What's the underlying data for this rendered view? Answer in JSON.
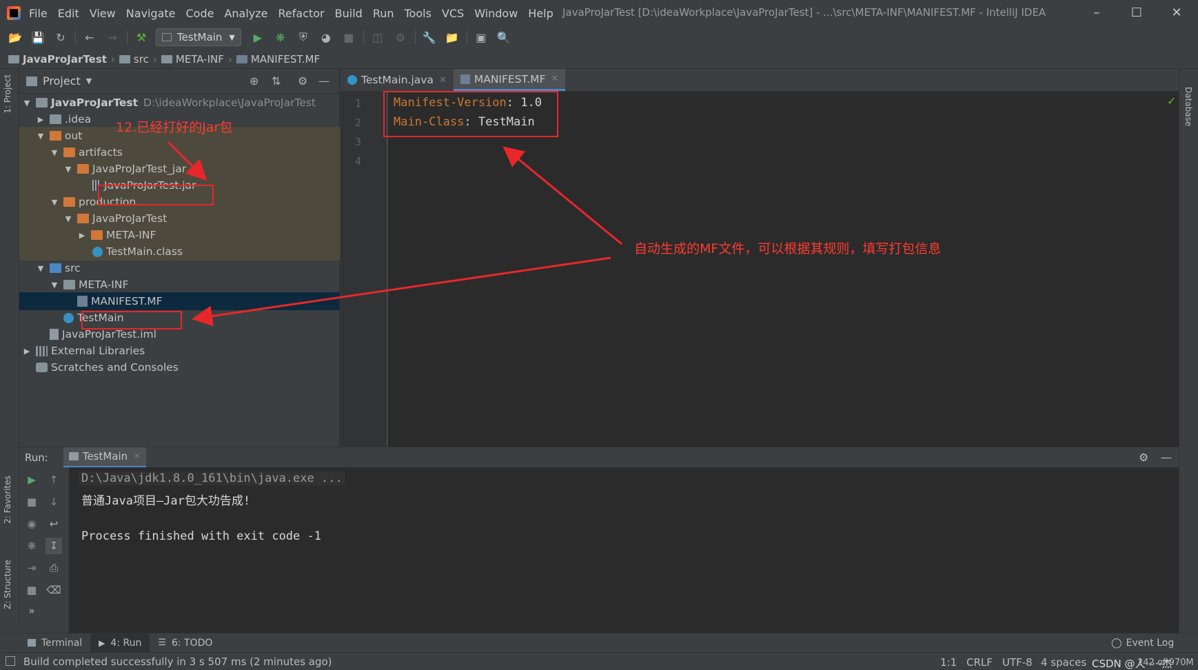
{
  "window": {
    "title": "JavaProJarTest [D:\\ideaWorkplace\\JavaProJarTest] - ...\\src\\META-INF\\MANIFEST.MF - IntelliJ IDEA",
    "menu": [
      "File",
      "Edit",
      "View",
      "Navigate",
      "Code",
      "Analyze",
      "Refactor",
      "Build",
      "Run",
      "Tools",
      "VCS",
      "Window",
      "Help"
    ]
  },
  "toolbar": {
    "run_config": "TestMain"
  },
  "breadcrumb": [
    "JavaProJarTest",
    "src",
    "META-INF",
    "MANIFEST.MF"
  ],
  "left_stripe": {
    "project_tab": "1: Project",
    "favorites_tab": "2: Favorites",
    "structure_tab": "Z: Structure"
  },
  "right_stripe": {
    "database_tab": "Database"
  },
  "project": {
    "title": "Project",
    "tree": [
      {
        "label": "JavaProJarTest",
        "path": "D:\\ideaWorkplace\\JavaProJarTest"
      },
      {
        "label": ".idea"
      },
      {
        "label": "out"
      },
      {
        "label": "artifacts"
      },
      {
        "label": "JavaProJarTest_jar"
      },
      {
        "label": "JavaProJarTest.jar"
      },
      {
        "label": "production"
      },
      {
        "label": "JavaProJarTest"
      },
      {
        "label": "META-INF"
      },
      {
        "label": "TestMain.class"
      },
      {
        "label": "src"
      },
      {
        "label": "META-INF"
      },
      {
        "label": "MANIFEST.MF"
      },
      {
        "label": "TestMain"
      },
      {
        "label": "JavaProJarTest.iml"
      },
      {
        "label": "External Libraries"
      },
      {
        "label": "Scratches and Consoles"
      }
    ]
  },
  "editor": {
    "tabs": [
      "TestMain.java",
      "MANIFEST.MF"
    ],
    "line_numbers": [
      "1",
      "2",
      "3",
      "4"
    ],
    "lines": [
      {
        "key": "Manifest-Version",
        "sep": ": ",
        "value": "1.0"
      },
      {
        "key": "Main-Class",
        "sep": ": ",
        "value": "TestMain"
      }
    ]
  },
  "run": {
    "label": "Run:",
    "tab": "TestMain",
    "console": [
      "D:\\Java\\jdk1.8.0_161\\bin\\java.exe ...",
      "普通Java项目—Jar包大功告成!",
      "",
      "Process finished with exit code -1"
    ]
  },
  "bottom_tabs": [
    "Terminal",
    "4: Run",
    "6: TODO"
  ],
  "event_log": "Event Log",
  "status": {
    "message": "Build completed successfully in 3 s 507 ms (2 minutes ago)",
    "position": "1:1",
    "line_sep": "CRLF",
    "encoding": "UTF-8",
    "indent": "4 spaces",
    "memory": "242 of 970M",
    "watermark": "CSDN @人·····杰"
  },
  "annotations": {
    "jar_note": "12.已经打好的Jar包",
    "mf_note": "自动生成的MF文件，可以根据其规则，填写打包信息"
  },
  "colors": {
    "annotation": "#e8272a",
    "keyword": "#cc7832",
    "selection": "#0d293e",
    "excluded": "#4d4a3d",
    "accent": "#4a88c7"
  }
}
